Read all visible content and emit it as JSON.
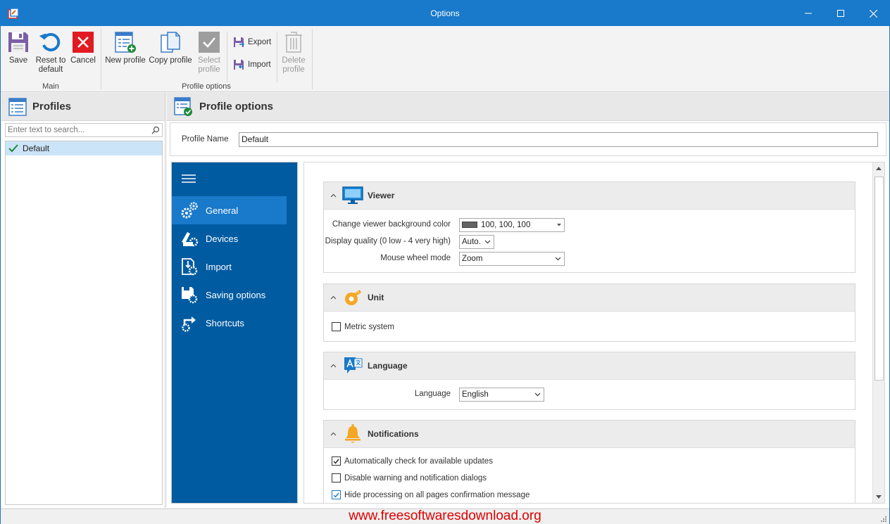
{
  "window": {
    "title": "Options"
  },
  "ribbon": {
    "main": {
      "save": "Save",
      "reset_line1": "Reset to",
      "reset_line2": "default",
      "cancel": "Cancel",
      "group_label": "Main"
    },
    "profile_options": {
      "new_profile": "New profile",
      "copy_profile": "Copy profile",
      "select_line1": "Select",
      "select_line2": "profile",
      "export": "Export",
      "import": "Import",
      "delete_line1": "Delete",
      "delete_line2": "profile",
      "group_label": "Profile options"
    }
  },
  "profiles_panel": {
    "title": "Profiles",
    "search_placeholder": "Enter text to search...",
    "items": [
      {
        "label": "Default",
        "selected": true
      }
    ]
  },
  "profile_options_panel": {
    "title": "Profile options",
    "profile_name_label": "Profile Name",
    "profile_name_value": "Default",
    "nav": [
      {
        "label": "General",
        "icon": "gears-icon",
        "active": true
      },
      {
        "label": "Devices",
        "icon": "devices-icon",
        "active": false
      },
      {
        "label": "Import",
        "icon": "import-gear-icon",
        "active": false
      },
      {
        "label": "Saving options",
        "icon": "save-gear-icon",
        "active": false
      },
      {
        "label": "Shortcuts",
        "icon": "shortcut-gear-icon",
        "active": false
      }
    ],
    "sections": {
      "viewer": {
        "title": "Viewer",
        "bg_color_label": "Change viewer background color",
        "bg_color_value": "100, 100, 100",
        "bg_color_swatch": "#646464",
        "quality_label": "Display quality (0 low - 4 very high)",
        "quality_value": "Auto.",
        "wheel_label": "Mouse wheel mode",
        "wheel_value": "Zoom"
      },
      "unit": {
        "title": "Unit",
        "metric_label": "Metric system",
        "metric_checked": false
      },
      "language": {
        "title": "Language",
        "language_label": "Language",
        "language_value": "English"
      },
      "notifications": {
        "title": "Notifications",
        "items": [
          {
            "label": "Automatically check for available updates",
            "checked": true
          },
          {
            "label": "Disable warning and notification dialogs",
            "checked": false
          },
          {
            "label": "Hide processing on all pages confirmation message",
            "checked": true
          }
        ]
      }
    }
  },
  "status": {
    "watermark": "www.freesoftwaresdownload.org"
  },
  "colors": {
    "titlebar": "#1979ca",
    "nav": "#005ba1",
    "nav_active": "#1979ca",
    "accent": "#1979ca"
  }
}
